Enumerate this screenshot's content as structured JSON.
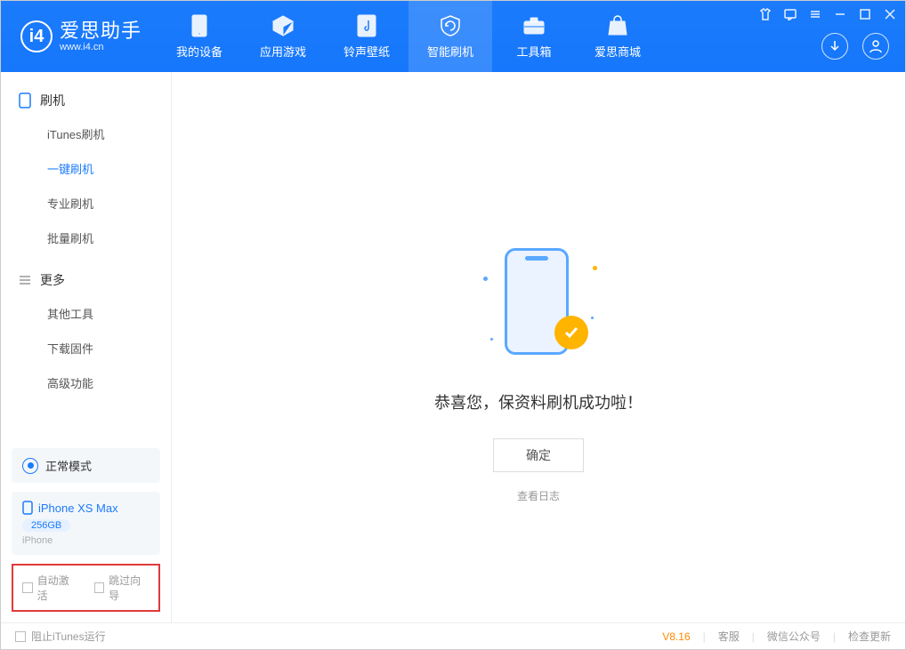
{
  "logo": {
    "title": "爱思助手",
    "subtitle": "www.i4.cn",
    "letter": "i4"
  },
  "nav": {
    "tabs": [
      {
        "label": "我的设备"
      },
      {
        "label": "应用游戏"
      },
      {
        "label": "铃声壁纸"
      },
      {
        "label": "智能刷机"
      },
      {
        "label": "工具箱"
      },
      {
        "label": "爱思商城"
      }
    ]
  },
  "sidebar": {
    "section1_title": "刷机",
    "items1": [
      {
        "label": "iTunes刷机"
      },
      {
        "label": "一键刷机"
      },
      {
        "label": "专业刷机"
      },
      {
        "label": "批量刷机"
      }
    ],
    "section2_title": "更多",
    "items2": [
      {
        "label": "其他工具"
      },
      {
        "label": "下载固件"
      },
      {
        "label": "高级功能"
      }
    ],
    "mode_label": "正常模式",
    "device": {
      "name": "iPhone XS Max",
      "storage": "256GB",
      "type": "iPhone"
    },
    "cb1": "自动激活",
    "cb2": "跳过向导"
  },
  "main": {
    "success_text": "恭喜您，保资料刷机成功啦！",
    "ok_button": "确定",
    "log_link": "查看日志"
  },
  "statusbar": {
    "block_itunes": "阻止iTunes运行",
    "version": "V8.16",
    "link1": "客服",
    "link2": "微信公众号",
    "link3": "检查更新"
  }
}
